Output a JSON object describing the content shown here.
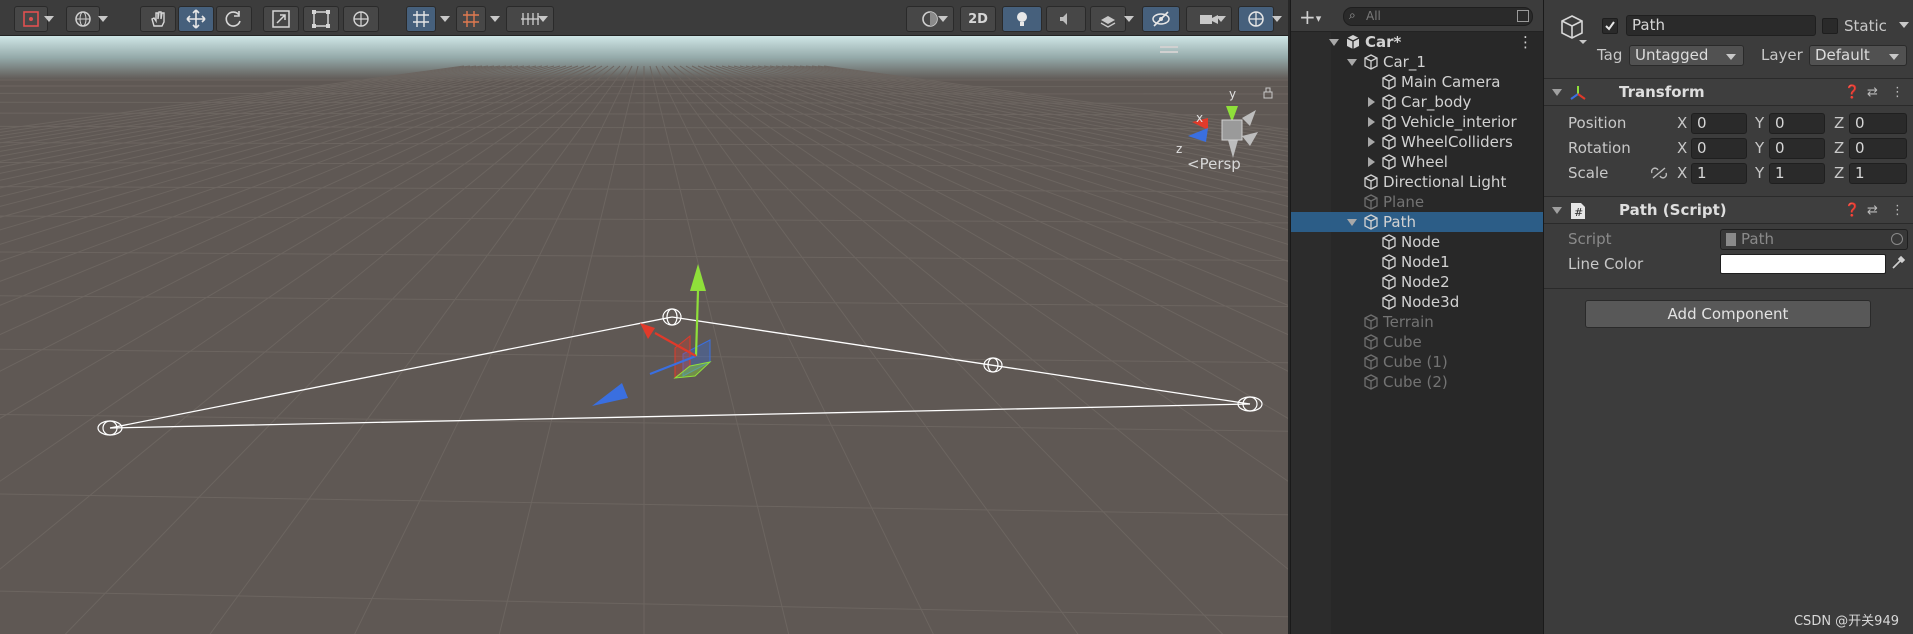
{
  "scene": {
    "persp_label": "Persp",
    "gizmo_axes": {
      "x": "x",
      "y": "y",
      "z": "z"
    },
    "toolbar": {
      "two_d_label": "2D",
      "colors": {
        "active_button": "#46607c",
        "button": "#474747"
      }
    },
    "tools": [
      {
        "icon": "hand-tool-icon"
      },
      {
        "icon": "move-tool-icon",
        "active": true
      },
      {
        "icon": "rotate-tool-icon"
      },
      {
        "icon": "scale-tool-icon"
      },
      {
        "icon": "rect-tool-icon"
      },
      {
        "icon": "transform-tool-icon"
      }
    ],
    "colors": {
      "background": "#5f5854",
      "horizon": "#b5d2d2",
      "path_line": "#ffffff",
      "gizmo_x": "#e03a2a",
      "gizmo_y": "#8fe03a",
      "gizmo_z": "#3a6fe0"
    }
  },
  "hierarchy": {
    "search_placeholder": "All",
    "items": [
      {
        "label": "Car*",
        "level": 0,
        "expanded": true,
        "bold": true,
        "scene": true
      },
      {
        "label": "Car_1",
        "level": 1,
        "expanded": true
      },
      {
        "label": "Main Camera",
        "level": 2
      },
      {
        "label": "Car_body",
        "level": 2,
        "collapsed": true
      },
      {
        "label": "Vehicle_interior",
        "level": 2,
        "collapsed": true
      },
      {
        "label": "WheelColliders",
        "level": 2,
        "collapsed": true
      },
      {
        "label": "Wheel",
        "level": 2,
        "collapsed": true
      },
      {
        "label": "Directional Light",
        "level": 1
      },
      {
        "label": "Plane",
        "level": 1,
        "dim": true
      },
      {
        "label": "Path",
        "level": 1,
        "expanded": true,
        "selected": true
      },
      {
        "label": "Node",
        "level": 2
      },
      {
        "label": "Node1",
        "level": 2
      },
      {
        "label": "Node2",
        "level": 2
      },
      {
        "label": "Node3d",
        "level": 2
      },
      {
        "label": "Terrain",
        "level": 1,
        "dim": true
      },
      {
        "label": "Cube",
        "level": 1,
        "dim": true
      },
      {
        "label": "Cube (1)",
        "level": 1,
        "dim": true
      },
      {
        "label": "Cube (2)",
        "level": 1,
        "dim": true
      }
    ],
    "colors": {
      "selected": "#2c5d87"
    }
  },
  "inspector": {
    "object_name": "Path",
    "active_checked": true,
    "static_label": "Static",
    "tag_label": "Tag",
    "tag_value": "Untagged",
    "layer_label": "Layer",
    "layer_value": "Default",
    "transform": {
      "title": "Transform",
      "rows": [
        {
          "label": "Position",
          "x": "0",
          "y": "0",
          "z": "0"
        },
        {
          "label": "Rotation",
          "x": "0",
          "y": "0",
          "z": "0"
        },
        {
          "label": "Scale",
          "x": "1",
          "y": "1",
          "z": "1"
        }
      ],
      "axis_labels": {
        "x": "X",
        "y": "Y",
        "z": "Z"
      }
    },
    "script_component": {
      "title": "Path (Script)",
      "script_label": "Script",
      "script_value": "Path",
      "line_color_label": "Line Color",
      "line_color_value": "#ffffff"
    },
    "add_component_label": "Add Component"
  },
  "watermark": "CSDN @开关949"
}
